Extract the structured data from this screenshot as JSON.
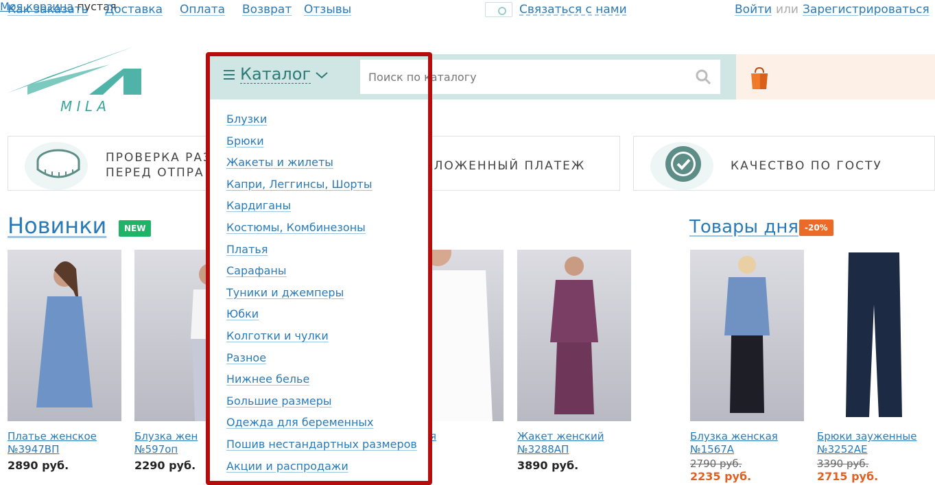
{
  "topnav": {
    "how_to_order": "Как заказать",
    "delivery": "Доставка",
    "payment": "Оплата",
    "returns": "Возврат",
    "reviews": "Отзывы",
    "contact": "Связаться с нами",
    "login": "Войти",
    "or": "или",
    "register": "Зарегистрироваться"
  },
  "logo": {
    "text": "M I L A"
  },
  "catalog": {
    "label": "Каталог",
    "items": [
      "Блузки",
      "Брюки",
      "Жакеты и жилеты",
      "Капри, Леггинсы, Шорты",
      "Кардиганы",
      "Костюмы, Комбинезоны",
      "Платья",
      "Сарафаны",
      "Туники и джемперы",
      "Юбки",
      "Колготки и чулки",
      "Разное",
      "Нижнее белье",
      "Большие размеры",
      "Одежда для беременных",
      "Пошив нестандартных размеров",
      "Акции и распродажи"
    ]
  },
  "search": {
    "placeholder": "Поиск по каталогу"
  },
  "cart": {
    "link": "Моя корзина",
    "status": "пустая"
  },
  "benefits": [
    {
      "text": "ПРОВЕРКА РАЗ\nПЕРЕД ОТПРА"
    },
    {
      "text": "АЛОЖЕННЫЙ ПЛАТЕЖ"
    },
    {
      "text": "КАЧЕСТВО ПО ГОСТУ"
    }
  ],
  "new_section": {
    "title": "Новинки",
    "badge": "NEW",
    "products": [
      {
        "name": "Платье женское №3947ВП",
        "name1": "Платье женское",
        "name2": "№3947ВП",
        "price": "2890 руб.",
        "color": "#6d93c7"
      },
      {
        "name1": "Блузка жен",
        "name2": "№597оп",
        "price": "2290 руб.",
        "color": "#e9eaf0"
      },
      {
        "name1": "женская",
        "name2": "ВП",
        "price": "уб.",
        "color": "#ffffff"
      },
      {
        "name1": "Жакет женский",
        "name2": "№3288АП",
        "price": "3890 руб.",
        "color": "#7a3d63"
      }
    ]
  },
  "deals_section": {
    "title": "Товары дня",
    "badge": "-20%",
    "products": [
      {
        "name1": "Блузка женская",
        "name2": "№1567А",
        "old_price": "2790 руб.",
        "new_price": "2235 руб.",
        "color": "#6f92c2"
      },
      {
        "name1": "Брюки зауженные",
        "name2": "№3252АЕ",
        "old_price": "3390 руб.",
        "new_price": "2715 руб.",
        "color": "#1d2a44"
      }
    ]
  }
}
